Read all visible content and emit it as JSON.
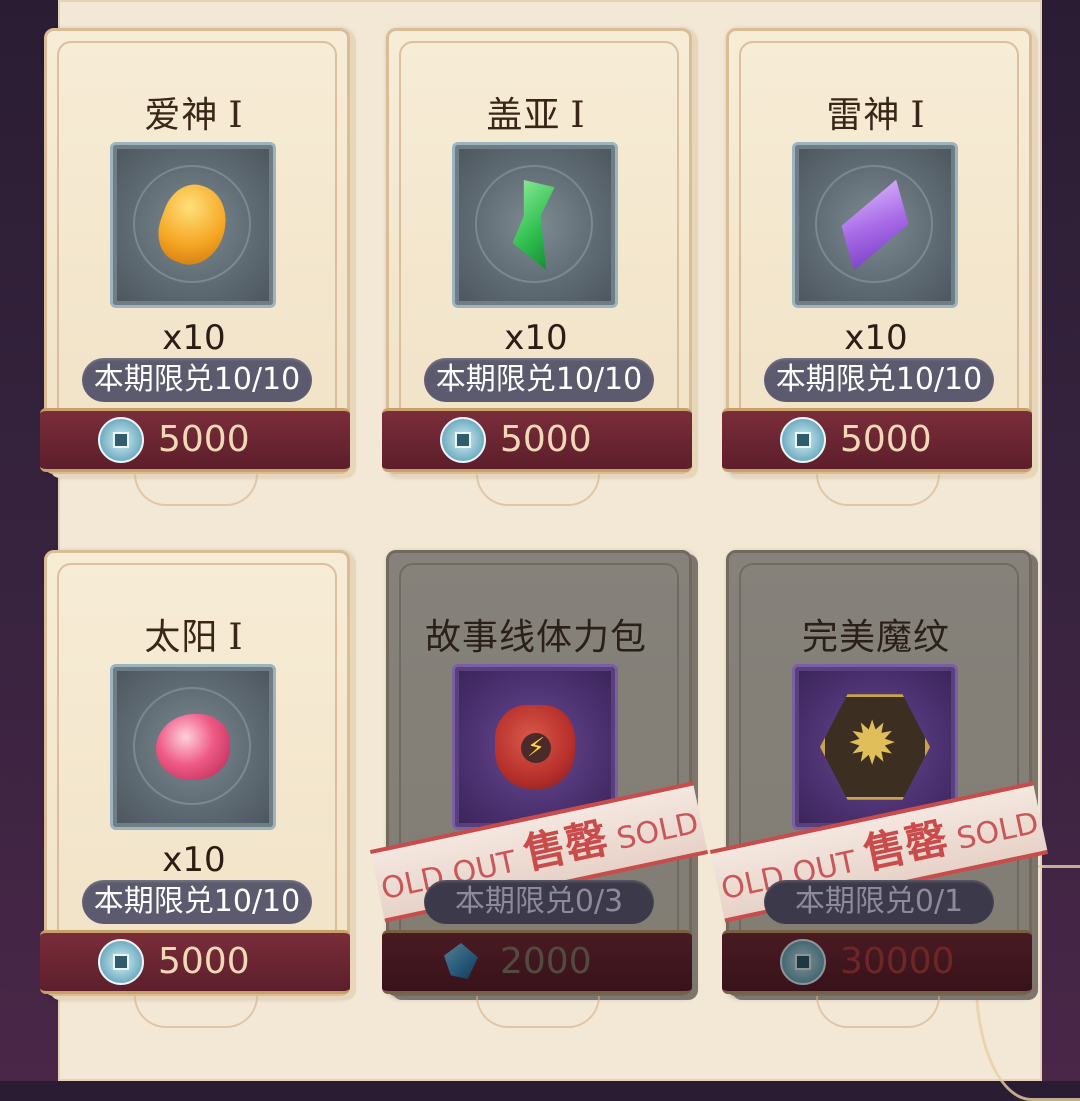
{
  "shop": {
    "items": [
      {
        "name": "爱神",
        "rank": "I",
        "qty": "x10",
        "limit": "本期限兑10/10",
        "price": "5000",
        "currency": "coin",
        "sold_out": false,
        "art": "amber"
      },
      {
        "name": "盖亚",
        "rank": "I",
        "qty": "x10",
        "limit": "本期限兑10/10",
        "price": "5000",
        "currency": "coin",
        "sold_out": false,
        "art": "jade"
      },
      {
        "name": "雷神",
        "rank": "I",
        "qty": "x10",
        "limit": "本期限兑10/10",
        "price": "5000",
        "currency": "coin",
        "sold_out": false,
        "art": "amethyst"
      },
      {
        "name": "太阳",
        "rank": "I",
        "qty": "x10",
        "limit": "本期限兑10/10",
        "price": "5000",
        "currency": "coin",
        "sold_out": false,
        "art": "ruby"
      },
      {
        "name": "故事线体力包",
        "rank": "",
        "qty": "",
        "limit": "本期限兑0/3",
        "price": "2000",
        "currency": "gem",
        "sold_out": true,
        "art": "stamina-bag"
      },
      {
        "name": "完美魔纹",
        "rank": "",
        "qty": "",
        "limit": "本期限兑0/1",
        "price": "30000",
        "currency": "coin",
        "sold_out": true,
        "art": "rune"
      }
    ],
    "sold_out_label": {
      "cn": "售罄",
      "en_left": "OLD OUT",
      "en_right": "SOLD"
    }
  }
}
